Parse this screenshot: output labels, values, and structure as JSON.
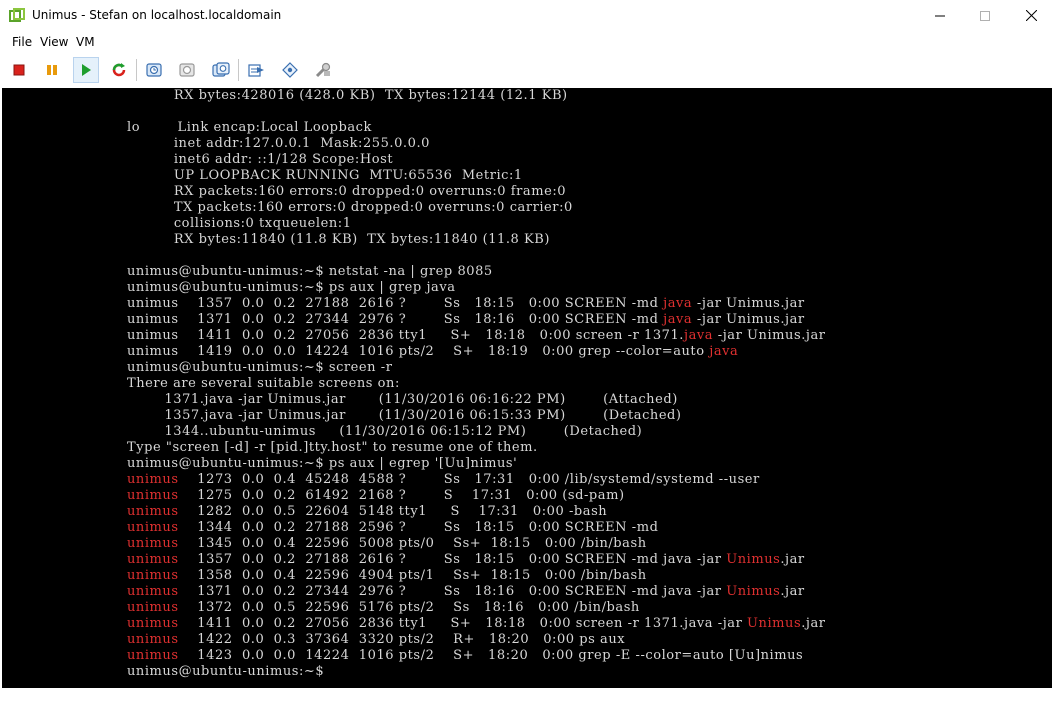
{
  "window": {
    "title": "Unimus - Stefan on localhost.localdomain"
  },
  "menu": {
    "file": "File",
    "view": "View",
    "vm": "VM"
  },
  "toolbar": {
    "buttons": [
      "stop-icon",
      "pause-icon",
      "play-icon",
      "reset-icon",
      "snapshot-icon",
      "revert-icon",
      "snapshot-manager-icon",
      "send-icon",
      "settings-icon",
      "tools-icon"
    ],
    "accent_stop": "#d9221c",
    "accent_pause": "#e89a0c",
    "accent_play": "#1e9e2e"
  },
  "terminal": {
    "lines": [
      [
        {
          "t": "          RX bytes:428016 (428.0 KB)  TX bytes:12144 (12.1 KB)"
        }
      ],
      [
        {
          "t": ""
        }
      ],
      [
        {
          "t": "lo        Link encap:Local Loopback"
        }
      ],
      [
        {
          "t": "          inet addr:127.0.0.1  Mask:255.0.0.0"
        }
      ],
      [
        {
          "t": "          inet6 addr: ::1/128 Scope:Host"
        }
      ],
      [
        {
          "t": "          UP LOOPBACK RUNNING  MTU:65536  Metric:1"
        }
      ],
      [
        {
          "t": "          RX packets:160 errors:0 dropped:0 overruns:0 frame:0"
        }
      ],
      [
        {
          "t": "          TX packets:160 errors:0 dropped:0 overruns:0 carrier:0"
        }
      ],
      [
        {
          "t": "          collisions:0 txqueuelen:1"
        }
      ],
      [
        {
          "t": "          RX bytes:11840 (11.8 KB)  TX bytes:11840 (11.8 KB)"
        }
      ],
      [
        {
          "t": ""
        }
      ],
      [
        {
          "t": "unimus@ubuntu-unimus:~$ netstat -na | grep 8085"
        }
      ],
      [
        {
          "t": "unimus@ubuntu-unimus:~$ ps aux | grep java"
        }
      ],
      [
        {
          "t": "unimus    1357  0.0  0.2  27188  2616 ?        Ss   18:15   0:00 SCREEN -md "
        },
        {
          "t": "java",
          "r": true
        },
        {
          "t": " -jar Unimus.jar"
        }
      ],
      [
        {
          "t": "unimus    1371  0.0  0.2  27344  2976 ?        Ss   18:16   0:00 SCREEN -md "
        },
        {
          "t": "java",
          "r": true
        },
        {
          "t": " -jar Unimus.jar"
        }
      ],
      [
        {
          "t": "unimus    1411  0.0  0.2  27056  2836 tty1     S+   18:18   0:00 screen -r 1371."
        },
        {
          "t": "java",
          "r": true
        },
        {
          "t": " -jar Unimus.jar"
        }
      ],
      [
        {
          "t": "unimus    1419  0.0  0.0  14224  1016 pts/2    S+   18:19   0:00 grep --color=auto "
        },
        {
          "t": "java",
          "r": true
        }
      ],
      [
        {
          "t": "unimus@ubuntu-unimus:~$ screen -r"
        }
      ],
      [
        {
          "t": "There are several suitable screens on:"
        }
      ],
      [
        {
          "t": "        1371.java -jar Unimus.jar       (11/30/2016 06:16:22 PM)        (Attached)"
        }
      ],
      [
        {
          "t": "        1357.java -jar Unimus.jar       (11/30/2016 06:15:33 PM)        (Detached)"
        }
      ],
      [
        {
          "t": "        1344..ubuntu-unimus     (11/30/2016 06:15:12 PM)        (Detached)"
        }
      ],
      [
        {
          "t": "Type \"screen [-d] -r [pid.]tty.host\" to resume one of them."
        }
      ],
      [
        {
          "t": "unimus@ubuntu-unimus:~$ ps aux | egrep '[Uu]nimus'"
        }
      ],
      [
        {
          "t": "unimus",
          "r": true
        },
        {
          "t": "    1273  0.0  0.4  45248  4588 ?        Ss   17:31   0:00 /lib/systemd/systemd --user"
        }
      ],
      [
        {
          "t": "unimus",
          "r": true
        },
        {
          "t": "    1275  0.0  0.2  61492  2168 ?        S    17:31   0:00 (sd-pam)"
        }
      ],
      [
        {
          "t": "unimus",
          "r": true
        },
        {
          "t": "    1282  0.0  0.5  22604  5148 tty1     S    17:31   0:00 -bash"
        }
      ],
      [
        {
          "t": "unimus",
          "r": true
        },
        {
          "t": "    1344  0.0  0.2  27188  2596 ?        Ss   18:15   0:00 SCREEN -md"
        }
      ],
      [
        {
          "t": "unimus",
          "r": true
        },
        {
          "t": "    1345  0.0  0.4  22596  5008 pts/0    Ss+  18:15   0:00 /bin/bash"
        }
      ],
      [
        {
          "t": "unimus",
          "r": true
        },
        {
          "t": "    1357  0.0  0.2  27188  2616 ?        Ss   18:15   0:00 SCREEN -md java -jar "
        },
        {
          "t": "Unimus",
          "r": true
        },
        {
          "t": ".jar"
        }
      ],
      [
        {
          "t": "unimus",
          "r": true
        },
        {
          "t": "    1358  0.0  0.4  22596  4904 pts/1    Ss+  18:15   0:00 /bin/bash"
        }
      ],
      [
        {
          "t": "unimus",
          "r": true
        },
        {
          "t": "    1371  0.0  0.2  27344  2976 ?        Ss   18:16   0:00 SCREEN -md java -jar "
        },
        {
          "t": "Unimus",
          "r": true
        },
        {
          "t": ".jar"
        }
      ],
      [
        {
          "t": "unimus",
          "r": true
        },
        {
          "t": "    1372  0.0  0.5  22596  5176 pts/2    Ss   18:16   0:00 /bin/bash"
        }
      ],
      [
        {
          "t": "unimus",
          "r": true
        },
        {
          "t": "    1411  0.0  0.2  27056  2836 tty1     S+   18:18   0:00 screen -r 1371.java -jar "
        },
        {
          "t": "Unimus",
          "r": true
        },
        {
          "t": ".jar"
        }
      ],
      [
        {
          "t": "unimus",
          "r": true
        },
        {
          "t": "    1422  0.0  0.3  37364  3320 pts/2    R+   18:20   0:00 ps aux"
        }
      ],
      [
        {
          "t": "unimus",
          "r": true
        },
        {
          "t": "    1423  0.0  0.0  14224  1016 pts/2    S+   18:20   0:00 grep -E --color=auto [Uu]nimus"
        }
      ],
      [
        {
          "t": "unimus@ubuntu-unimus:~$"
        }
      ]
    ]
  }
}
